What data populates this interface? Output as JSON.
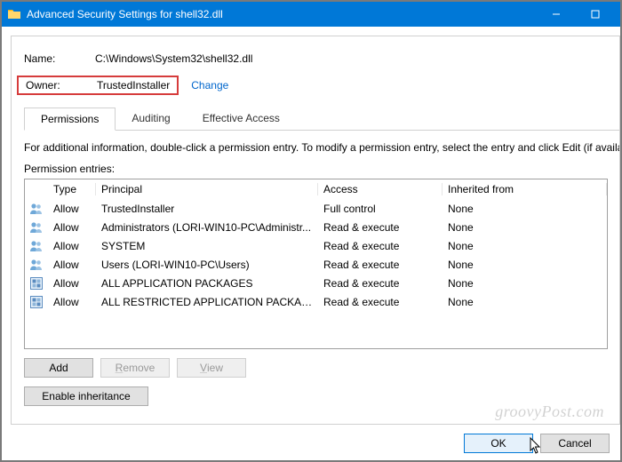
{
  "window": {
    "title": "Advanced Security Settings for shell32.dll"
  },
  "fields": {
    "name_label": "Name:",
    "name_value": "C:\\Windows\\System32\\shell32.dll",
    "owner_label": "Owner:",
    "owner_value": "TrustedInstaller",
    "change_link": "Change"
  },
  "tabs": {
    "permissions": "Permissions",
    "auditing": "Auditing",
    "effective": "Effective Access"
  },
  "info_text": "For additional information, double-click a permission entry. To modify a permission entry, select the entry and click Edit (if availa",
  "entries_label": "Permission entries:",
  "columns": {
    "type": "Type",
    "principal": "Principal",
    "access": "Access",
    "inherited": "Inherited from"
  },
  "rows": [
    {
      "icon": "group",
      "type": "Allow",
      "principal": "TrustedInstaller",
      "access": "Full control",
      "inherited": "None"
    },
    {
      "icon": "group",
      "type": "Allow",
      "principal": "Administrators (LORI-WIN10-PC\\Administr...",
      "access": "Read & execute",
      "inherited": "None"
    },
    {
      "icon": "group",
      "type": "Allow",
      "principal": "SYSTEM",
      "access": "Read & execute",
      "inherited": "None"
    },
    {
      "icon": "group",
      "type": "Allow",
      "principal": "Users (LORI-WIN10-PC\\Users)",
      "access": "Read & execute",
      "inherited": "None"
    },
    {
      "icon": "pkg",
      "type": "Allow",
      "principal": "ALL APPLICATION PACKAGES",
      "access": "Read & execute",
      "inherited": "None"
    },
    {
      "icon": "pkg",
      "type": "Allow",
      "principal": "ALL RESTRICTED APPLICATION PACKAGES",
      "access": "Read & execute",
      "inherited": "None"
    }
  ],
  "buttons": {
    "add": "Add",
    "remove": "Remove",
    "view": "View",
    "enable_inheritance": "Enable inheritance",
    "ok": "OK",
    "cancel": "Cancel"
  },
  "watermark": "groovyPost.com"
}
